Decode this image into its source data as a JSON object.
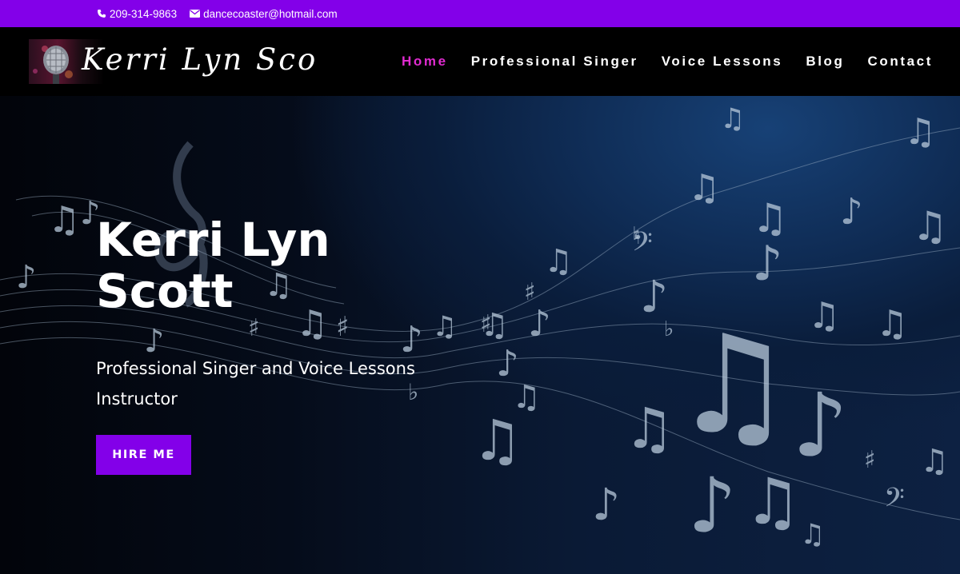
{
  "topbar": {
    "phone": "209-314-9863",
    "email": "dancecoaster@hotmail.com",
    "phone_icon": "phone-icon",
    "email_icon": "envelope-icon"
  },
  "header": {
    "logo_text": "Kerri Lyn Scott",
    "nav": [
      "Home",
      "Professional Singer",
      "Voice Lessons",
      "Blog",
      "Contact"
    ],
    "active": "Home"
  },
  "hero": {
    "title_line1": "Kerri Lyn",
    "title_line2": "Scott",
    "subtitle_line1": "Professional Singer and Voice Lessons",
    "subtitle_line2": "Instructor",
    "cta": "HIRE ME",
    "background": "music-notes-on-staff"
  },
  "colors": {
    "accent": "#8300e9",
    "active_nav": "#e02bd0",
    "header_bg": "#000000",
    "hero_bg": "#0a1d3b"
  }
}
